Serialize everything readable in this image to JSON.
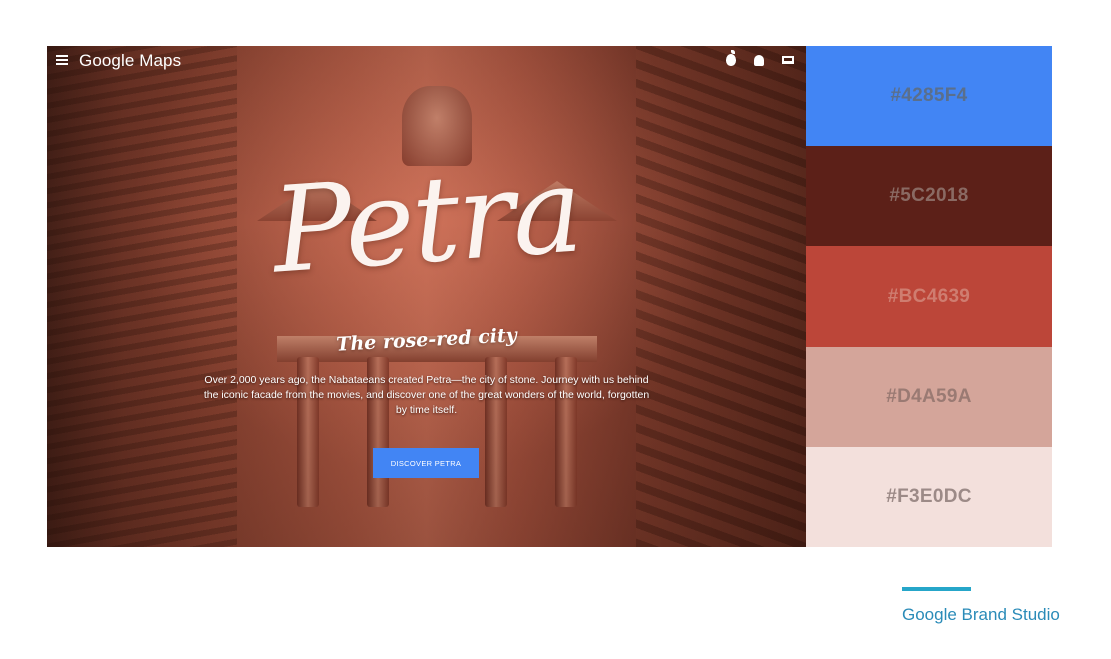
{
  "header": {
    "brand": "Google Maps",
    "platform_icons": [
      "apple-icon",
      "android-icon",
      "laptop-icon"
    ]
  },
  "hero": {
    "title": "Petra",
    "subtitle": "The rose-red city",
    "description": "Over 2,000 years ago, the Nabataeans created Petra—the city of stone. Journey with us behind the iconic facade from the movies, and discover one of the great wonders of the world, forgotten by time itself.",
    "cta_label": "DISCOVER PETRA",
    "cta_color": "#4285F4"
  },
  "palette": [
    {
      "hex": "#4285F4",
      "color": "#4285F4",
      "text_color": "#5a6f8c"
    },
    {
      "hex": "#5C2018",
      "color": "#5C2018",
      "text_color": "#8a6a63"
    },
    {
      "hex": "#BC4639",
      "color": "#BC4639",
      "text_color": "#cf7d70"
    },
    {
      "hex": "#D4A59A",
      "color": "#D4A59A",
      "text_color": "#9a7a73"
    },
    {
      "hex": "#F3E0DC",
      "color": "#F3E0DC",
      "text_color": "#9c8a87"
    }
  ],
  "footer": {
    "credit": "Google Brand Studio"
  }
}
